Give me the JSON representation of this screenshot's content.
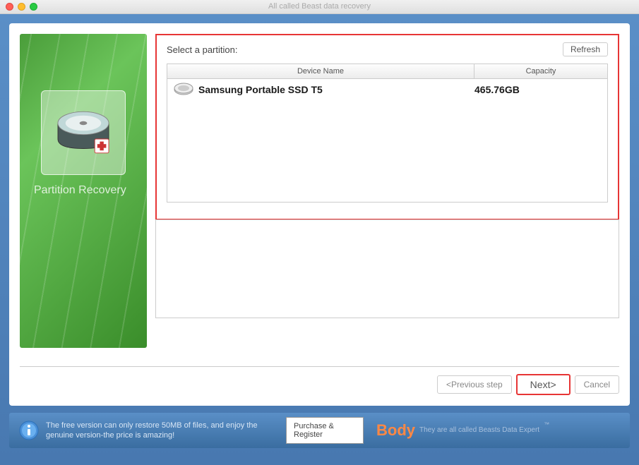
{
  "window": {
    "title": "All called Beast data recovery"
  },
  "sidebar": {
    "title": "Partition Recovery"
  },
  "partition": {
    "label": "Select a partition:",
    "refresh": "Refresh",
    "headers": {
      "name": "Device Name",
      "capacity": "Capacity"
    },
    "devices": [
      {
        "name": "Samsung Portable SSD T5",
        "capacity": "465.76GB"
      }
    ]
  },
  "nav": {
    "prev": "<Previous step",
    "next": "Next>",
    "cancel": "Cancel"
  },
  "footer": {
    "info": "The free version can only restore 50MB of files, and enjoy the genuine version-the price is amazing!",
    "purchase": "Purchase & Register",
    "brand": "Body",
    "tagline": "They are all called Beasts Data Expert",
    "tm": "™"
  }
}
